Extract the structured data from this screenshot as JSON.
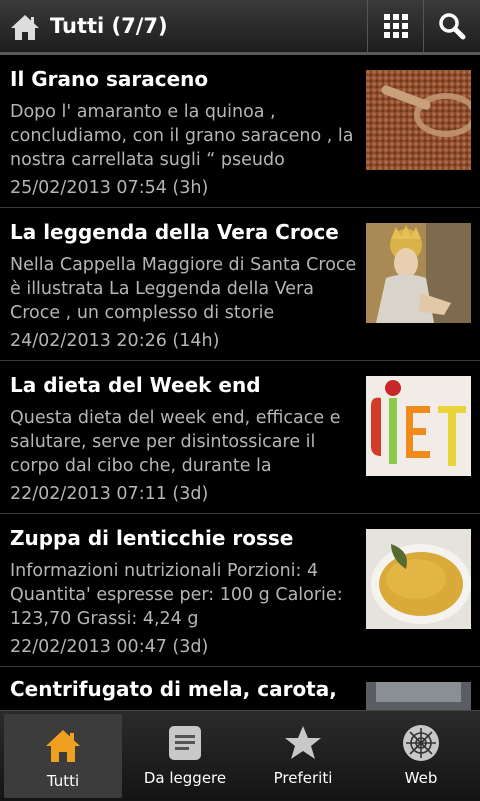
{
  "header": {
    "title": "Tutti (7/7)",
    "home_icon": "home-icon",
    "grid_icon": "grid-icon",
    "search_icon": "search-icon"
  },
  "articles": [
    {
      "title": "Il Grano saraceno",
      "desc": "Dopo l' amaranto e la quinoa , concludiamo, con il grano saraceno , la nostra carrellata sugli “ pseudo",
      "date": "25/02/2013 07:54 (3h)"
    },
    {
      "title": "La leggenda della Vera Croce",
      "desc": "Nella Cappella Maggiore di Santa Croce è illustrata  La Leggenda  della Vera Croce , un complesso di storie",
      "date": "24/02/2013 20:26 (14h)"
    },
    {
      "title": "La dieta del Week end",
      "desc": "Questa dieta del week end, efficace e salutare, serve per disintossicare  il corpo dal cibo che, durante la",
      "date": "22/02/2013 07:11 (3d)"
    },
    {
      "title": "Zuppa di lenticchie rosse",
      "desc": "Informazioni nutrizionali Porzioni:  4 Quantita' espresse per:  100 g Calorie:  123,70 Grassi:  4,24 g",
      "date": "22/02/2013 00:47 (3d)"
    },
    {
      "title": "Centrifugato di mela, carota,",
      "desc": "",
      "date": ""
    }
  ],
  "tabs": [
    {
      "label": "Tutti",
      "icon": "home-icon",
      "active": true
    },
    {
      "label": "Da leggere",
      "icon": "document-icon",
      "active": false
    },
    {
      "label": "Preferiti",
      "icon": "star-icon",
      "active": false
    },
    {
      "label": "Web",
      "icon": "web-icon",
      "active": false
    }
  ],
  "colors": {
    "accent": "#f0a020",
    "text": "#ffffff",
    "secondary_text": "#b5b5b5"
  }
}
